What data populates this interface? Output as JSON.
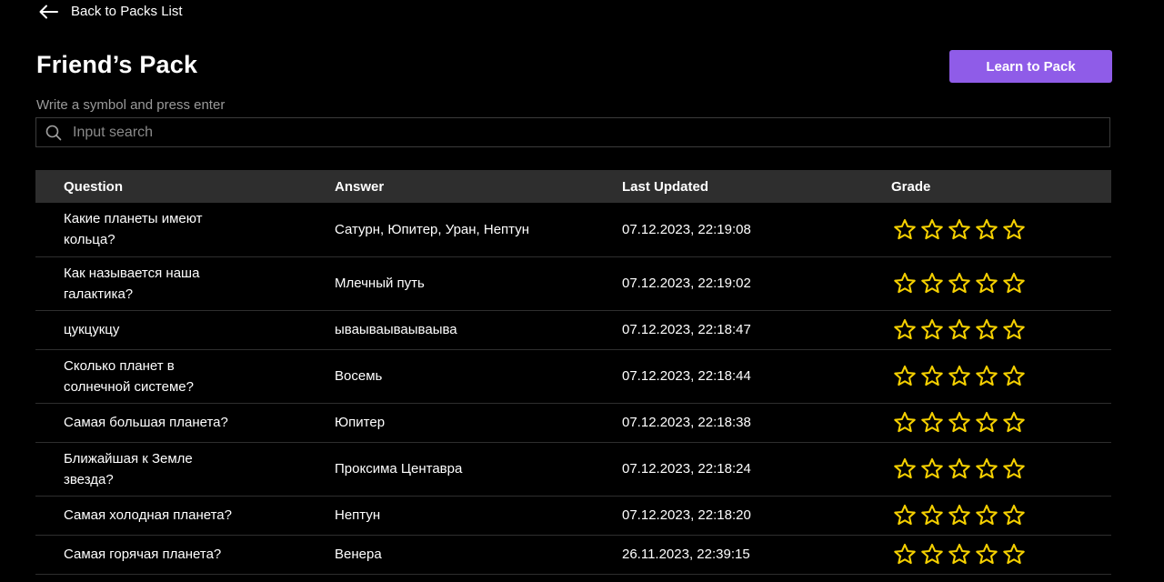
{
  "nav": {
    "back_label": "Back to Packs List"
  },
  "header": {
    "title": "Friend’s Pack",
    "learn_button_label": "Learn to Pack"
  },
  "search": {
    "hint": "Write a symbol and press enter",
    "placeholder": "Input search",
    "value": ""
  },
  "table": {
    "columns": {
      "question": "Question",
      "answer": "Answer",
      "updated": "Last Updated",
      "grade": "Grade"
    },
    "rows": [
      {
        "question": "Какие планеты имеют кольца?",
        "answer": "Сатурн, Юпитер, Уран, Нептун",
        "updated": "07.12.2023, 22:19:08",
        "grade": 0
      },
      {
        "question": "Как называется наша галактика?",
        "answer": "Млечный путь",
        "updated": "07.12.2023, 22:19:02",
        "grade": 0
      },
      {
        "question": "цукцукцу",
        "answer": "ываываываываыва",
        "updated": "07.12.2023, 22:18:47",
        "grade": 0
      },
      {
        "question": "Сколько планет в солнечной системе?",
        "answer": "Восемь",
        "updated": "07.12.2023, 22:18:44",
        "grade": 0
      },
      {
        "question": "Самая большая планета?",
        "answer": "Юпитер",
        "updated": "07.12.2023, 22:18:38",
        "grade": 0
      },
      {
        "question": "Ближайшая к Земле звезда?",
        "answer": "Проксима Центавра",
        "updated": "07.12.2023, 22:18:24",
        "grade": 0
      },
      {
        "question": "Самая холодная планета?",
        "answer": "Нептун",
        "updated": "07.12.2023, 22:18:20",
        "grade": 0
      },
      {
        "question": "Самая горячая планета?",
        "answer": "Венера",
        "updated": "26.11.2023, 22:39:15",
        "grade": 0
      }
    ],
    "max_grade": 5
  },
  "icons": {
    "back": "arrow-left-icon",
    "search": "search-icon",
    "star": "star-outline-icon"
  },
  "colors": {
    "background": "#000000",
    "accent": "#8f5ce8",
    "header_row": "#2e2e2e",
    "star": "#f5d000"
  }
}
